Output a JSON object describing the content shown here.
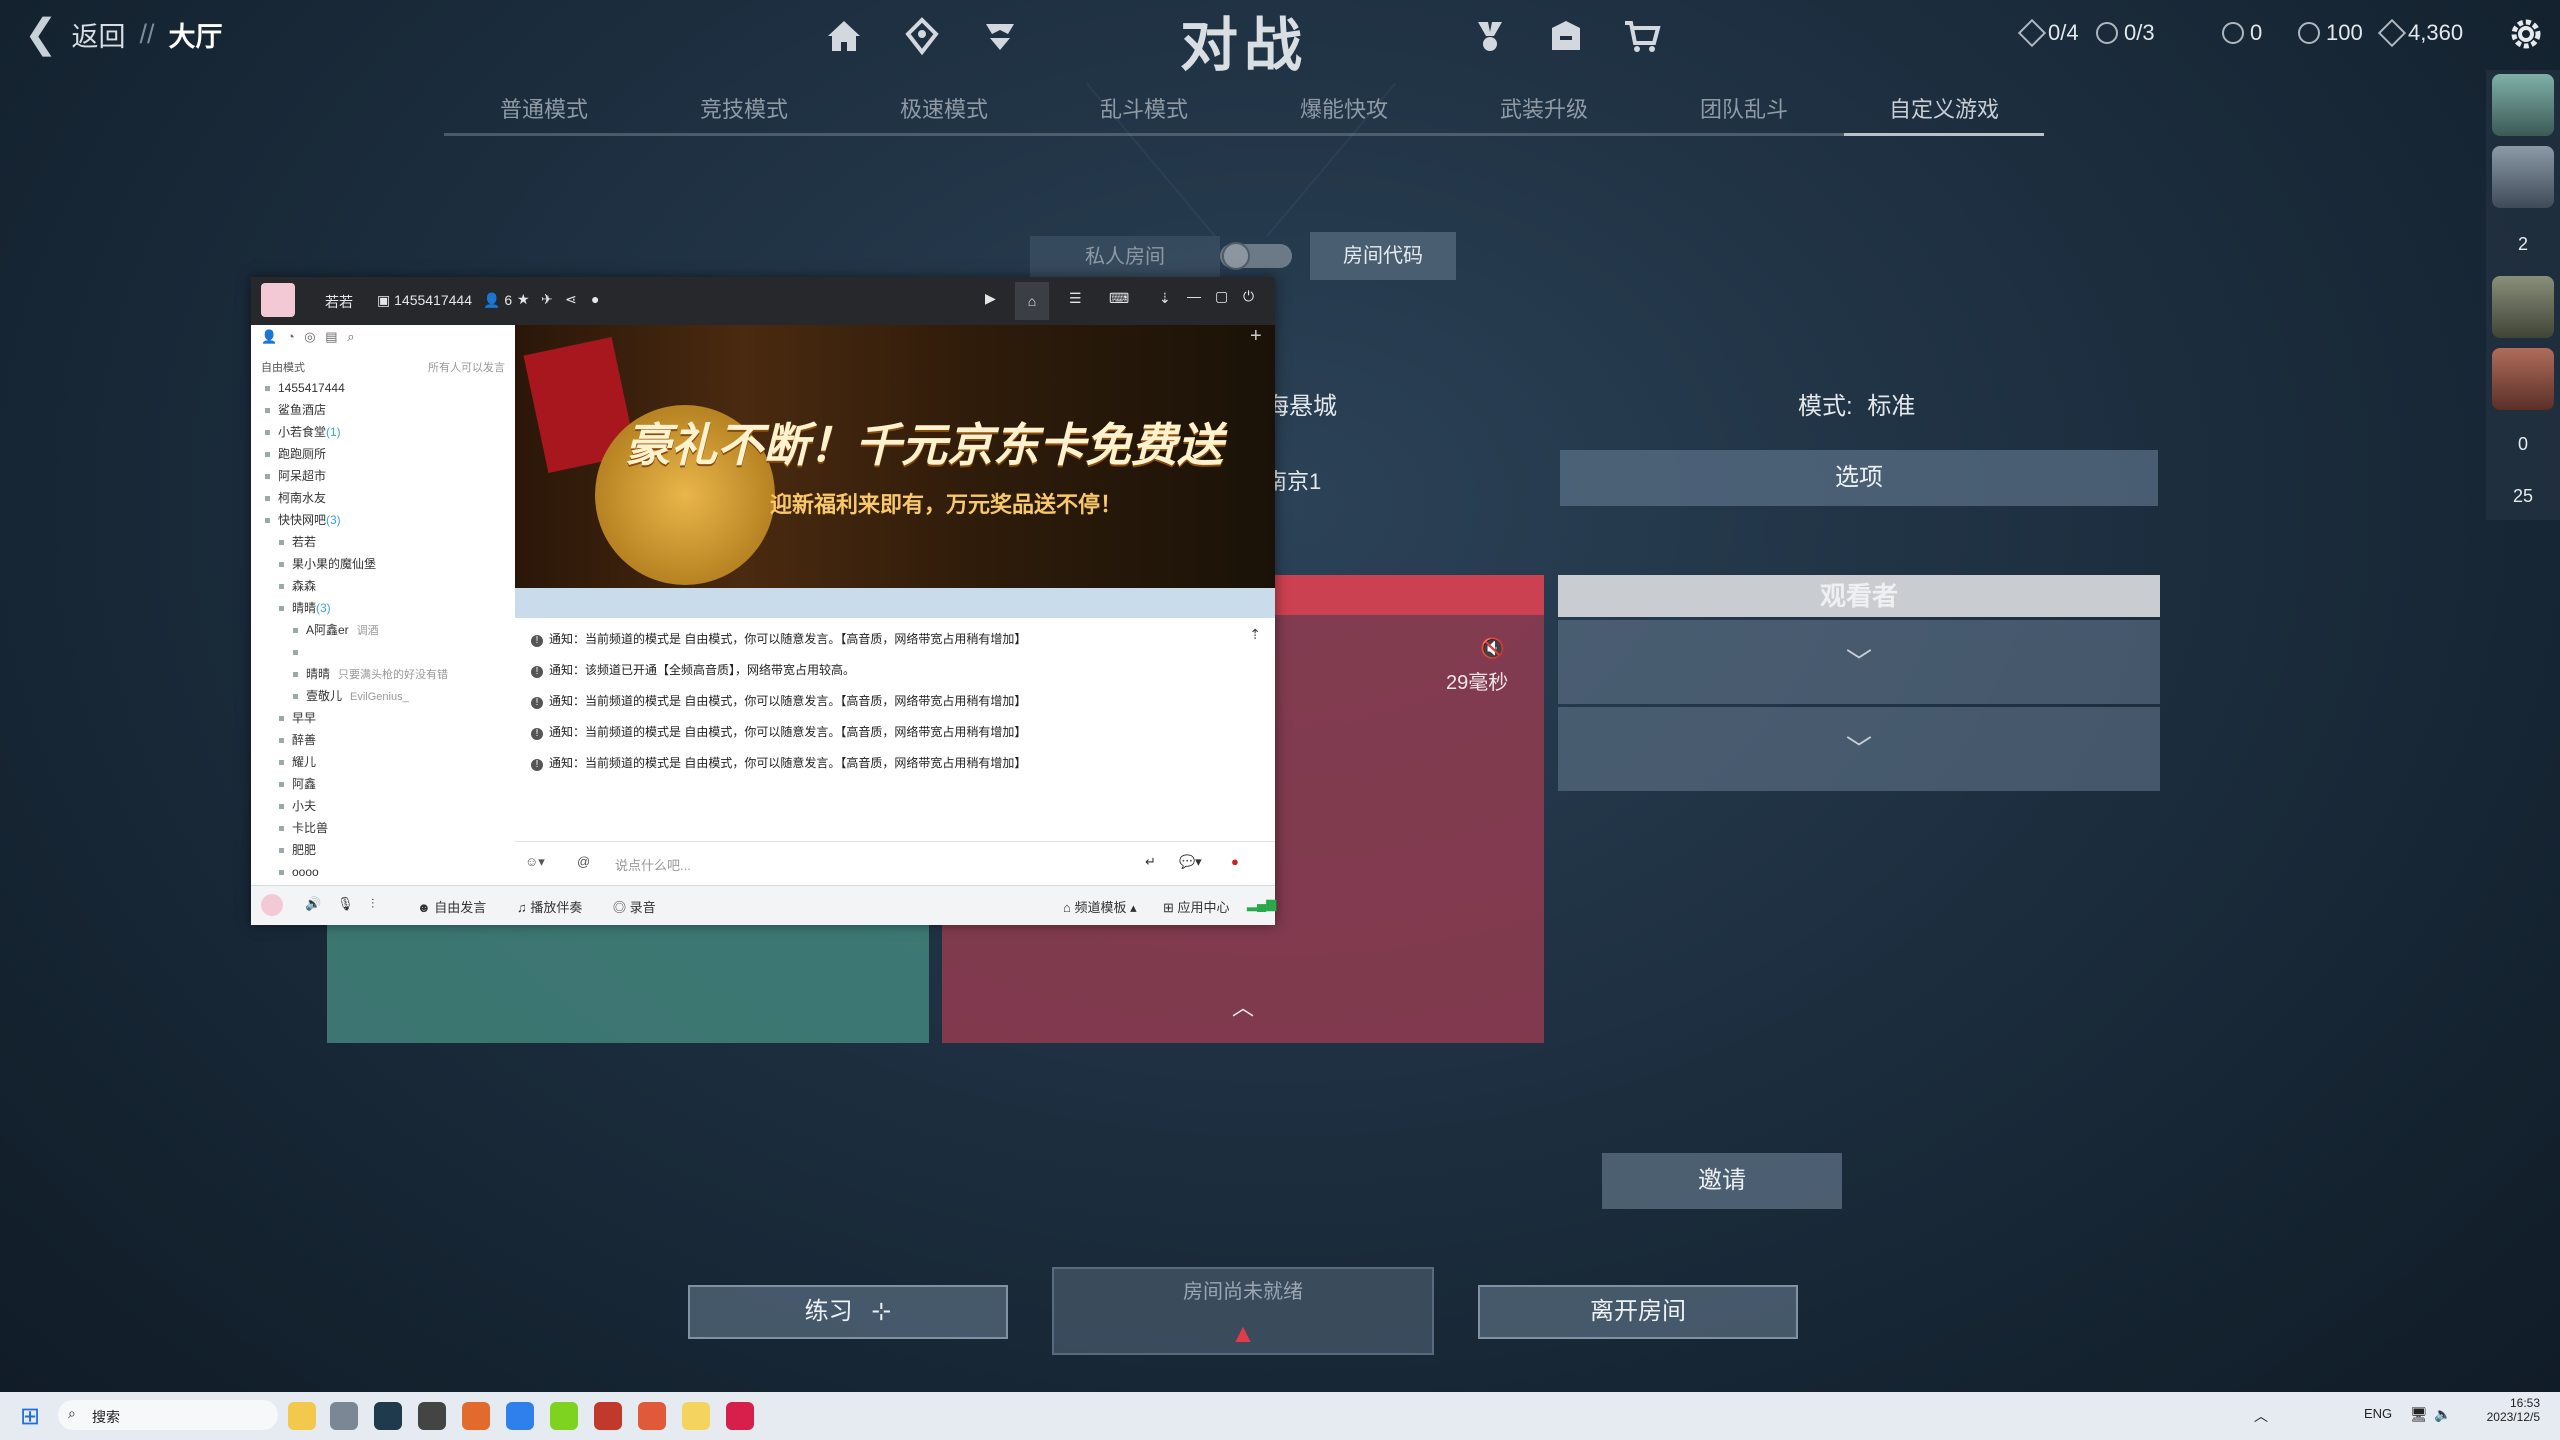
{
  "header": {
    "back_label": "返回",
    "separator": "//",
    "lobby_label": "大厅",
    "title": "对战",
    "stats": {
      "slots": "0/4",
      "slots2": "0/3",
      "vp": "0",
      "rp": "100",
      "kp": "4,360"
    }
  },
  "tabs": [
    {
      "label": "普通模式"
    },
    {
      "label": "竞技模式"
    },
    {
      "label": "极速模式"
    },
    {
      "label": "乱斗模式"
    },
    {
      "label": "爆能快攻"
    },
    {
      "label": "武装升级"
    },
    {
      "label": "团队乱斗"
    },
    {
      "label": "自定义游戏"
    }
  ],
  "room": {
    "private_label": "私人房间",
    "code_button": "房间代码",
    "map_fragment": "海悬城",
    "server_fragment": "南京1",
    "mode_label": "模式:",
    "mode_value": "标准",
    "options_button": "选项",
    "spectators_title": "观看者",
    "ping": "29毫秒",
    "invite_button": "邀请",
    "practice_button": "练习",
    "not_ready": "房间尚未就绪",
    "leave_button": "离开房间"
  },
  "sidebar": {
    "count_a": "2",
    "count_b": "0",
    "count_c": "25"
  },
  "chat": {
    "nickname": "若若",
    "channel_id": "1455417444",
    "members": "6",
    "mode": "自由模式",
    "permission": "所有人可以发言",
    "tree": [
      {
        "label": "1455417444",
        "indent": 0
      },
      {
        "label": "鲨鱼酒店",
        "indent": 0
      },
      {
        "label": "小若食堂",
        "count": "(1)",
        "indent": 0
      },
      {
        "label": "跑跑厕所",
        "indent": 0
      },
      {
        "label": "阿呆超市",
        "indent": 0
      },
      {
        "label": "柯南水友",
        "indent": 0
      },
      {
        "label": "快快网吧",
        "count": "(3)",
        "indent": 0
      },
      {
        "label": "若若",
        "indent": 1
      },
      {
        "label": "果小果的魔仙堡",
        "indent": 1
      },
      {
        "label": "森森",
        "indent": 1
      },
      {
        "label": "晴晴",
        "count": "(3)",
        "indent": 1
      },
      {
        "label": "A阿鑫er",
        "tag": "调酒",
        "indent": 2
      },
      {
        "label": "",
        "indent": 2
      },
      {
        "label": "晴晴",
        "tag": "只要满头枪的好没有错",
        "indent": 2
      },
      {
        "label": "壹敬儿",
        "tag": "EvilGenius_",
        "indent": 2
      },
      {
        "label": "早早",
        "indent": 1
      },
      {
        "label": "醉善",
        "indent": 1
      },
      {
        "label": "耀儿",
        "indent": 1
      },
      {
        "label": "阿鑫",
        "indent": 1
      },
      {
        "label": "小夫",
        "indent": 1
      },
      {
        "label": "卡比兽",
        "indent": 1
      },
      {
        "label": "肥肥",
        "indent": 1
      },
      {
        "label": "oooo",
        "indent": 1
      }
    ],
    "banner_title": "豪礼不断！千元京东卡免费送",
    "banner_sub": "迎新福利来即有，万元奖品送不停！",
    "messages": [
      "通知：当前频道的模式是 自由模式，你可以随意发言。【高音质，网络带宽占用稍有增加】",
      "通知：该频道已开通【全频高音质】，网络带宽占用较高。",
      "通知：当前频道的模式是 自由模式，你可以随意发言。【高音质，网络带宽占用稍有增加】",
      "通知：当前频道的模式是 自由模式，你可以随意发言。【高音质，网络带宽占用稍有增加】",
      "通知：当前频道的模式是 自由模式，你可以随意发言。【高音质，网络带宽占用稍有增加】"
    ],
    "input_placeholder": "说点什么吧...",
    "bottom": {
      "free_speech": "自由发言",
      "play_music": "播放伴奏",
      "record": "录音",
      "channel_template": "频道模板",
      "app_center": "应用中心"
    }
  },
  "taskbar": {
    "search": "搜索",
    "lang": "ENG",
    "time": "16:53",
    "date": "2023/12/5"
  },
  "colors": {
    "red_team": "#cc4152",
    "green_team": "#468c82",
    "accent": "#c9cdd2"
  }
}
